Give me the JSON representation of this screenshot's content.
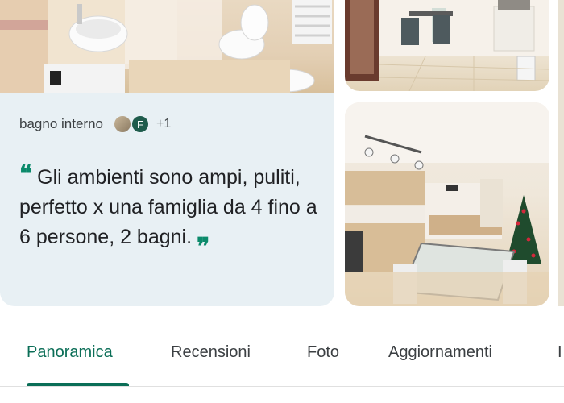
{
  "gallery": {
    "photo_label": "bagno interno",
    "avatar_initial": "F",
    "extra_count": "+1",
    "review": {
      "quote_open": "❝",
      "text": "Gli ambienti sono ampi, puliti, perfetto x una famiglia da 4 fino a 6 persone, 2 bagni.",
      "quote_close": "❞"
    }
  },
  "tabs": [
    {
      "label": "Panoramica",
      "selected": true
    },
    {
      "label": "Recensioni",
      "selected": false
    },
    {
      "label": "Foto",
      "selected": false
    },
    {
      "label": "Aggiornamenti",
      "selected": false
    },
    {
      "label": "I",
      "selected": false
    }
  ],
  "colors": {
    "accent": "#0b6e57",
    "card_background": "#e8f0f4"
  }
}
